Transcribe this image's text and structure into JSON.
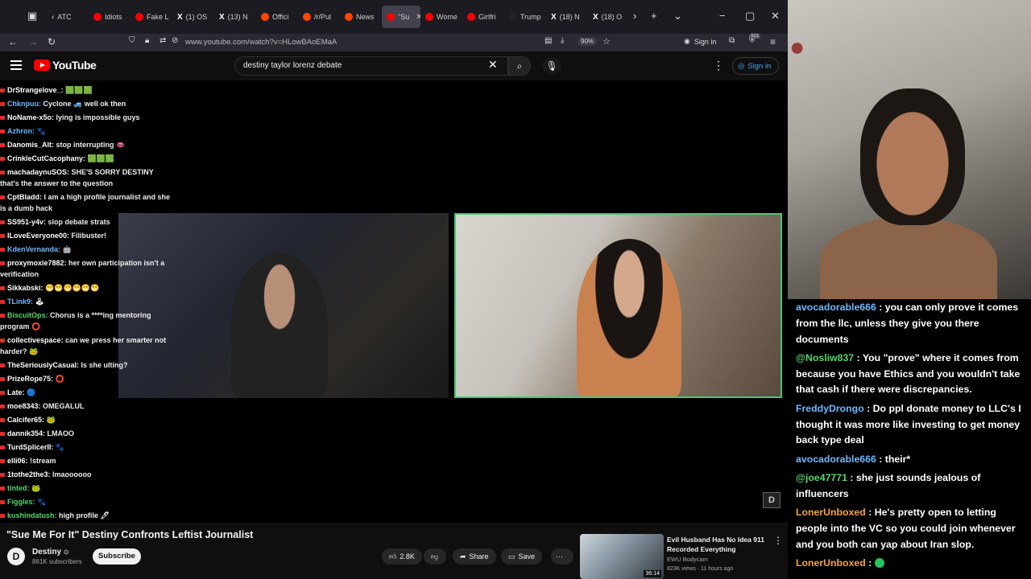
{
  "browser": {
    "tabs": [
      {
        "label": "ATC",
        "color": "#aaaaaa",
        "glyph": "‹"
      },
      {
        "label": "Idiots",
        "color": "#ff0000"
      },
      {
        "label": "Fake L",
        "color": "#ff0000"
      },
      {
        "label": "(1) OS",
        "color": "#ffffff",
        "glyph": "X"
      },
      {
        "label": "(13) N",
        "color": "#ffffff",
        "glyph": "X"
      },
      {
        "label": "Offici",
        "color": "#ff4500"
      },
      {
        "label": "/r/Pul",
        "color": "#ff4500"
      },
      {
        "label": "News",
        "color": "#ff4500"
      },
      {
        "label": "\"Su",
        "color": "#ff0000",
        "active": true
      },
      {
        "label": "Wome",
        "color": "#ff0000"
      },
      {
        "label": "Girlfri",
        "color": "#ff0000"
      },
      {
        "label": "Trump",
        "color": "#222222"
      },
      {
        "label": "(18) N",
        "color": "#ffffff",
        "glyph": "X"
      },
      {
        "label": "(18) O",
        "color": "#ffffff",
        "glyph": "X"
      }
    ],
    "url": "www.youtube.com/watch?v=HLowBAoEMaA",
    "zoom": "90%",
    "sign_in": "Sign in",
    "badge": "321"
  },
  "youtube": {
    "logo": "YouTube",
    "search_value": "destiny taylor lorenz debate",
    "sign_in": "Sign in"
  },
  "left_chat": [
    {
      "user": "DrStrangelove_:",
      "color": "#ffffff",
      "text": "🟩🟩🟩"
    },
    {
      "user": "Chknpuu:",
      "color": "#6fb8ff",
      "text": "Cyclone 🚙 well ok then"
    },
    {
      "user": "NoName-x5o:",
      "color": "#ffffff",
      "text": "lying is impossible guys"
    },
    {
      "user": "Azhron:",
      "color": "#6fb8ff",
      "text": "🐾"
    },
    {
      "user": "Danomis_Alt:",
      "color": "#ffffff",
      "text": "stop interrupting 👄"
    },
    {
      "user": "CrinkleCutCacophany:",
      "color": "#ffffff",
      "text": "🟩🟩🟩"
    },
    {
      "user": "machadaynuSOS:",
      "color": "#ffffff",
      "text": "SHE'S SORRY DESTINY that's the answer to the question",
      "wrap": true
    },
    {
      "user": "CptBladd:",
      "color": "#ffffff",
      "text": "I am a high profile journalist and she is a dumb hack",
      "wrap": true
    },
    {
      "user": "SS951-y4v:",
      "color": "#ffffff",
      "text": "slop debate strats"
    },
    {
      "user": "ILoveEveryone00:",
      "color": "#ffffff",
      "text": "Filibuster!"
    },
    {
      "user": "KdenVernanda:",
      "color": "#6fb8ff",
      "text": "🤖"
    },
    {
      "user": "proxymoxie7882:",
      "color": "#ffffff",
      "text": "her own participation isn't a verification",
      "wrap": true
    },
    {
      "user": "Sikkabski:",
      "color": "#ffffff",
      "text": "😁😁😁😁😁😁"
    },
    {
      "user": "TLink9:",
      "color": "#6fb8ff",
      "text": "🕹"
    },
    {
      "user": "BiscuitOps:",
      "color": "#57d46b",
      "text": "Chorus is a ****ing mentoring program ⭕",
      "wrap": true
    },
    {
      "user": "collectivespace:",
      "color": "#ffffff",
      "text": "can we press her smarter not harder? 🐸",
      "wrap": true
    },
    {
      "user": "TheSeriouslyCasual:",
      "color": "#ffffff",
      "text": "Is she ulting?"
    },
    {
      "user": "PrizeRope75:",
      "color": "#ffffff",
      "text": "⭕"
    },
    {
      "user": "Late:",
      "color": "#ffffff",
      "text": "🔵"
    },
    {
      "user": "moe8343:",
      "color": "#ffffff",
      "text": "OMEGALUL"
    },
    {
      "user": "Calcifer65:",
      "color": "#ffffff",
      "text": "🐸"
    },
    {
      "user": "dannik354:",
      "color": "#ffffff",
      "text": "LMAOO"
    },
    {
      "user": "TurdSplicerII:",
      "color": "#ffffff",
      "text": "🐾"
    },
    {
      "user": "elli06:",
      "color": "#ffffff",
      "text": "!stream"
    },
    {
      "user": "1tothe2the3:",
      "color": "#ffffff",
      "text": "lmaoooooo"
    },
    {
      "user": "tinted:",
      "color": "#57d46b",
      "text": "🐸"
    },
    {
      "user": "Figgles:",
      "color": "#57d46b",
      "text": "🐾"
    },
    {
      "user": "kushindatush:",
      "color": "#57d46b",
      "text": "high profile 🖊"
    }
  ],
  "video": {
    "title": "\"Sue Me For It\" Destiny Confronts Leftist Journalist",
    "channel": "Destiny",
    "verified": "⊙",
    "subscribers": "861K subscribers",
    "subscribe": "Subscribe",
    "likes": "2.8K",
    "share": "Share",
    "save": "Save",
    "more": "···",
    "watermark": "D"
  },
  "recommended": {
    "title": "Evil Husband Has No Idea 911 Recorded Everything",
    "channel": "EWU Bodycam",
    "meta": "823K views · 11 hours ago",
    "duration": "36:14"
  },
  "right_chat": [
    {
      "user": "avocadorable666",
      "color": "#6fb8ff",
      "text": ": you can only prove it comes from the llc, unless they give you there documents"
    },
    {
      "user": "@Nosliw837",
      "color": "#57d46b",
      "text": ": You \"prove\" where it comes from because you have Ethics and you wouldn't take that cash if there were discrepancies."
    },
    {
      "user": "FreddyDrongo",
      "color": "#6fb8ff",
      "text": ": Do ppl donate money to LLC's I thought it was more like investing to get money back type deal"
    },
    {
      "user": "avocadorable666",
      "color": "#6fb8ff",
      "text": ": their*"
    },
    {
      "user": "@joe47771",
      "color": "#57d46b",
      "text": ": she just sounds jealous of influencers"
    },
    {
      "user": "LonerUnboxed",
      "color": "#f4a53a",
      "text": ": He's pretty open to letting people into the VC so you could join whenever and you both can yap about Iran slop."
    },
    {
      "user": "LonerUnboxed",
      "color": "#f4a53a",
      "text": ":",
      "emote": true
    }
  ]
}
